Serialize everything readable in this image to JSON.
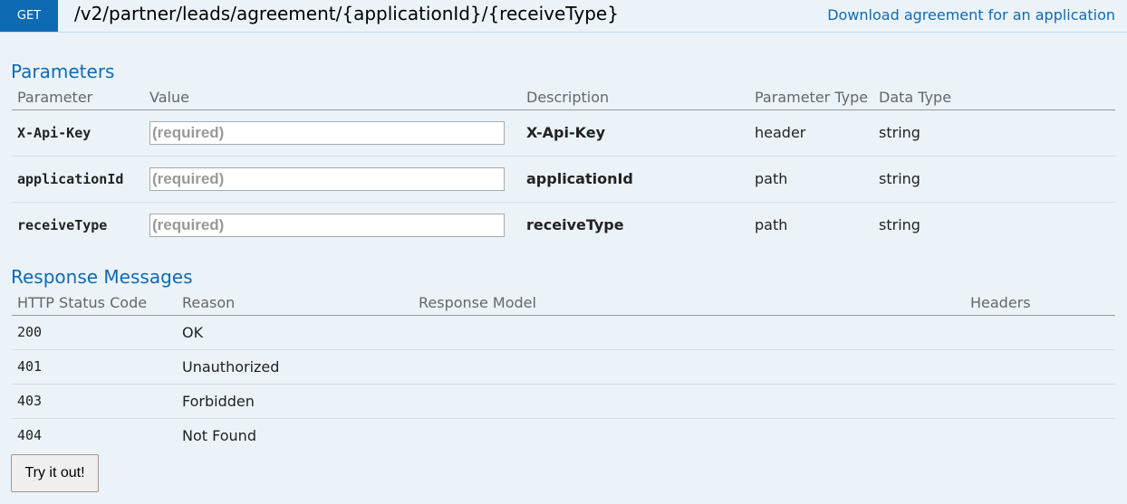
{
  "operation": {
    "method": "GET",
    "path": "/v2/partner/leads/agreement/{applicationId}/{receiveType}",
    "summary": "Download agreement for an application",
    "method_color": "#0f6ab4"
  },
  "parameters": {
    "title": "Parameters",
    "columns": [
      "Parameter",
      "Value",
      "Description",
      "Parameter Type",
      "Data Type"
    ],
    "rows": [
      {
        "name": "X-Api-Key",
        "placeholder": "(required)",
        "description": "X-Api-Key",
        "param_type": "header",
        "data_type": "string"
      },
      {
        "name": "applicationId",
        "placeholder": "(required)",
        "description": "applicationId",
        "param_type": "path",
        "data_type": "string"
      },
      {
        "name": "receiveType",
        "placeholder": "(required)",
        "description": "receiveType",
        "param_type": "path",
        "data_type": "string"
      }
    ]
  },
  "responses": {
    "title": "Response Messages",
    "columns": [
      "HTTP Status Code",
      "Reason",
      "Response Model",
      "Headers"
    ],
    "rows": [
      {
        "code": "200",
        "reason": "OK"
      },
      {
        "code": "401",
        "reason": "Unauthorized"
      },
      {
        "code": "403",
        "reason": "Forbidden"
      },
      {
        "code": "404",
        "reason": "Not Found"
      }
    ]
  },
  "try_button_label": "Try it out!"
}
